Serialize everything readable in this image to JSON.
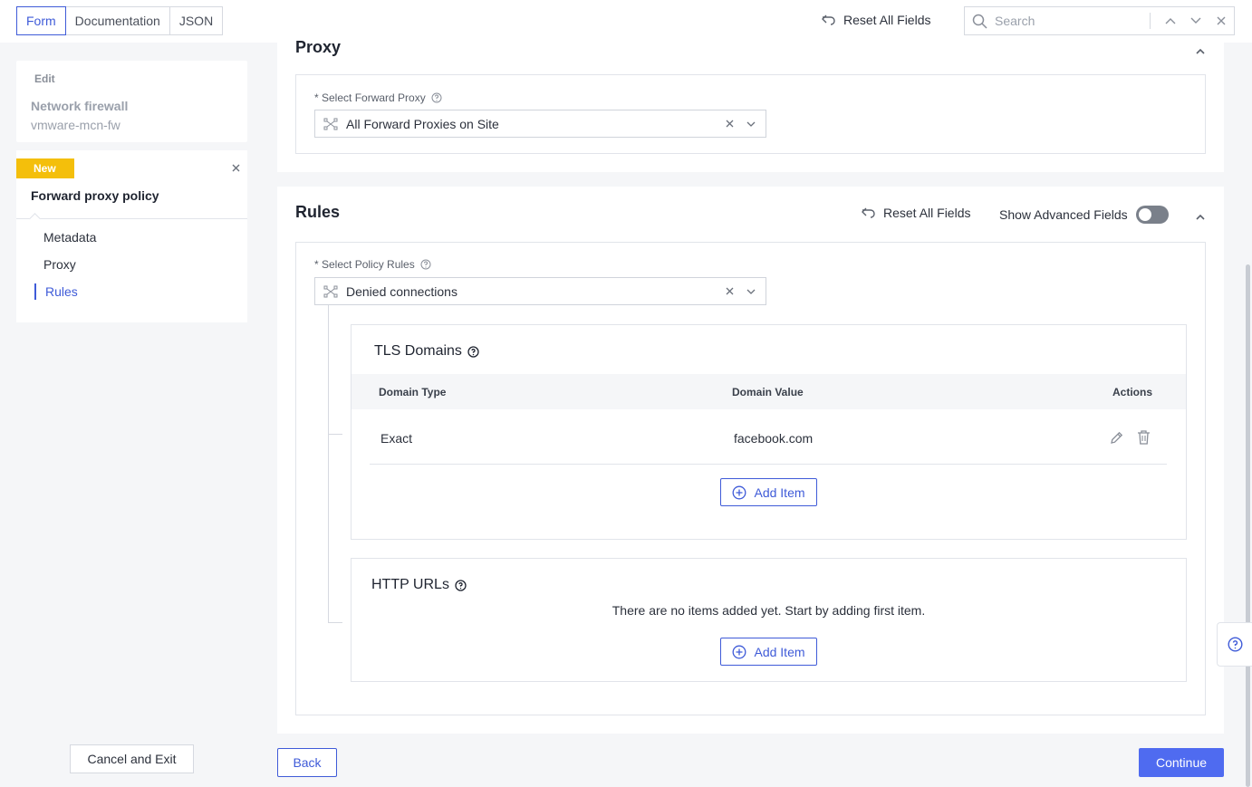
{
  "top_tabs": [
    "Form",
    "Documentation",
    "JSON"
  ],
  "topbar": {
    "reset_label": "Reset All Fields",
    "search_placeholder": "Search"
  },
  "sidebar": {
    "edit_label": "Edit",
    "edit_name": "Network firewall",
    "edit_sub": "vmware-mcn-fw",
    "new_badge": "New",
    "new_title": "Forward proxy policy",
    "nav": [
      "Metadata",
      "Proxy",
      "Rules"
    ],
    "active_nav": "Rules",
    "cancel_label": "Cancel and Exit"
  },
  "proxy": {
    "title": "Proxy",
    "field_label": "* Select Forward Proxy",
    "field_value": "All Forward Proxies on Site"
  },
  "rules": {
    "title": "Rules",
    "reset_label": "Reset All Fields",
    "advanced_label": "Show Advanced Fields",
    "advanced_on": false,
    "field_label": "* Select Policy Rules",
    "field_value": "Denied connections",
    "tls": {
      "title": "TLS Domains",
      "columns": [
        "Domain Type",
        "Domain Value",
        "Actions"
      ],
      "rows": [
        {
          "type": "Exact",
          "value": "facebook.com"
        }
      ],
      "add_label": "Add Item"
    },
    "http": {
      "title": "HTTP URLs",
      "empty_message": "There are no items added yet. Start by adding first item.",
      "add_label": "Add Item"
    }
  },
  "footer": {
    "back_label": "Back",
    "continue_label": "Continue"
  },
  "colors": {
    "accent": "#3f5bd8",
    "primary_button": "#4f6bf0",
    "badge": "#f4bf0b"
  }
}
